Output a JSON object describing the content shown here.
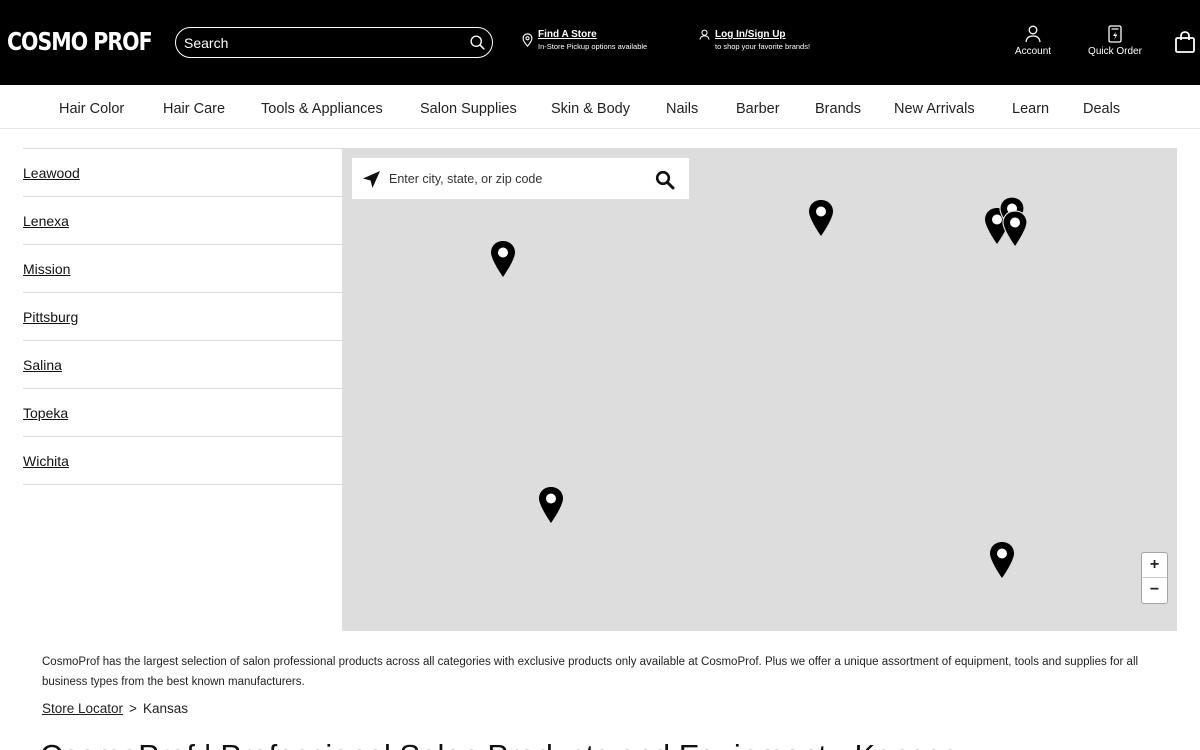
{
  "header": {
    "logo": "COSMO PROF",
    "search_placeholder": "Search",
    "find_store": {
      "title": "Find A Store",
      "subtitle": "In-Store Pickup options available"
    },
    "login": {
      "title": "Log In/Sign Up",
      "subtitle": "to shop your favorite brands!"
    },
    "account_label": "Account",
    "quick_order_label": "Quick Order"
  },
  "nav": {
    "items": [
      "Hair Color",
      "Hair Care",
      "Tools & Appliances",
      "Salon Supplies",
      "Skin & Body",
      "Nails",
      "Barber",
      "Brands",
      "New Arrivals",
      "Learn",
      "Deals"
    ]
  },
  "cities": [
    "Leawood",
    "Lenexa",
    "Mission",
    "Pittsburg",
    "Salina",
    "Topeka",
    "Wichita"
  ],
  "map": {
    "search_placeholder": "Enter city, state, or zip code",
    "zoom_in": "+",
    "zoom_out": "−",
    "background": "#dddddd"
  },
  "description": "CosmoProf has the largest selection of salon professional products across all categories with exclusive products only available at CosmoProf. Plus we offer a unique assortment of equipment, tools and supplies for all business types from the best known manufacturers.",
  "breadcrumb": {
    "root": "Store Locator",
    "separator": ">",
    "current": "Kansas"
  },
  "page_title": "CosmoProf | Professional Salon Products and Equipment - Kansas",
  "colors": {
    "header_bg": "#000000",
    "map_bg": "#dddddd",
    "text": "#111111"
  }
}
